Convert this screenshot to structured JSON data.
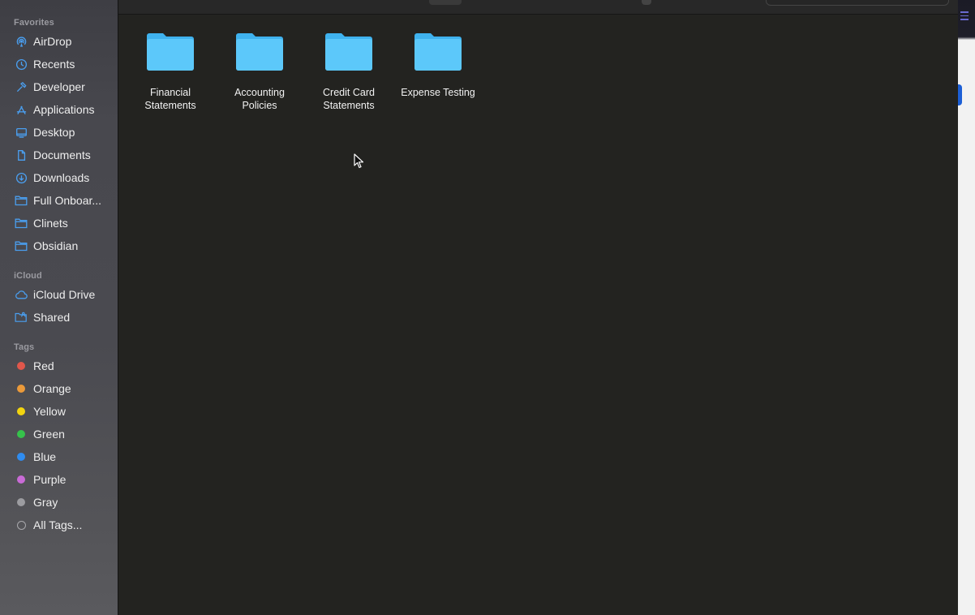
{
  "sidebar": {
    "favorites_header": "Favorites",
    "favorites": [
      {
        "label": "AirDrop",
        "icon": "airdrop-icon"
      },
      {
        "label": "Recents",
        "icon": "clock-icon"
      },
      {
        "label": "Developer",
        "icon": "hammer-icon"
      },
      {
        "label": "Applications",
        "icon": "applications-icon"
      },
      {
        "label": "Desktop",
        "icon": "desktop-icon"
      },
      {
        "label": "Documents",
        "icon": "document-icon"
      },
      {
        "label": "Downloads",
        "icon": "download-icon"
      },
      {
        "label": "Full Onboar...",
        "icon": "folder-icon"
      },
      {
        "label": "Clinets",
        "icon": "folder-icon"
      },
      {
        "label": "Obsidian",
        "icon": "folder-icon"
      }
    ],
    "icloud_header": "iCloud",
    "icloud": [
      {
        "label": "iCloud Drive",
        "icon": "cloud-icon"
      },
      {
        "label": "Shared",
        "icon": "shared-folder-icon"
      }
    ],
    "tags_header": "Tags",
    "tags": [
      {
        "label": "Red",
        "color": "#e0574b"
      },
      {
        "label": "Orange",
        "color": "#eb9a3a"
      },
      {
        "label": "Yellow",
        "color": "#f2d40f"
      },
      {
        "label": "Green",
        "color": "#36c24b"
      },
      {
        "label": "Blue",
        "color": "#2f8cf0"
      },
      {
        "label": "Purple",
        "color": "#c96bd6"
      },
      {
        "label": "Gray",
        "color": "#9c9ca0"
      },
      {
        "label": "All Tags...",
        "color": "outline"
      }
    ]
  },
  "content": {
    "folders": [
      {
        "name": "Financial\nStatements"
      },
      {
        "name": "Accounting\nPolicies"
      },
      {
        "name": "Credit Card\nStatements"
      },
      {
        "name": "Expense Testing"
      }
    ]
  },
  "colors": {
    "sidebar_icon_accent": "#4a9ff0",
    "folder_blue": "#5cc8fa",
    "folder_tab": "#3fb2ee",
    "content_bg": "#232320"
  }
}
